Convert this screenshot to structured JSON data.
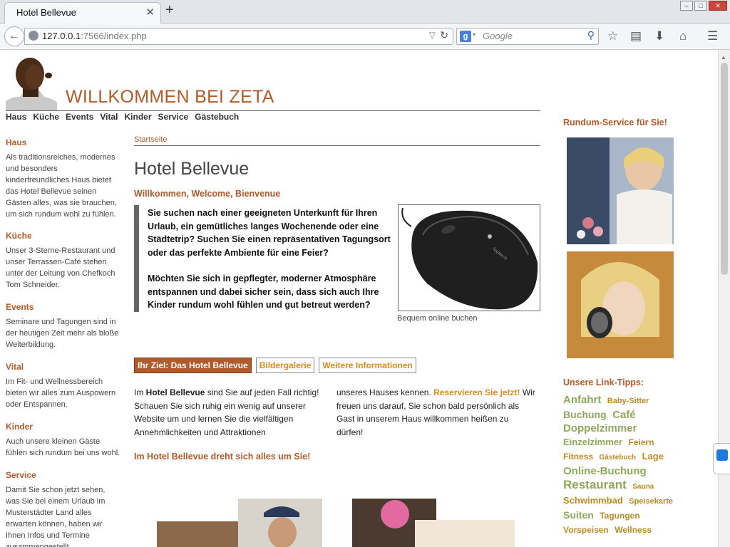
{
  "browser": {
    "tab_title": "Hotel Bellevue",
    "tab_close": "✕",
    "new_tab": "+",
    "url_host": "127.0.0.1",
    "url_path": ":7566/index.php",
    "search_placeholder": "Google",
    "search_engine_icon": "google-icon"
  },
  "site": {
    "welcome": "WILLKOMMEN BEI ZETA",
    "nav": [
      "Haus",
      "Küche",
      "Events",
      "Vital",
      "Kinder",
      "Service",
      "Gästebuch"
    ]
  },
  "sidebar_left": [
    {
      "title": "Haus",
      "text": "Als traditionsreiches, modernes und besonders kinderfreundliches Haus bietet das Hotel Bellevue seinen Gästen alles, was sie brauchen, um sich rundum wohl zu fühlen."
    },
    {
      "title": "Küche",
      "text": "Unser 3-Sterne-Restaurant und unser Terrassen-Café stehen unter der Leitung von Chefkoch Tom Schneider."
    },
    {
      "title": "Events",
      "text": "Seminare und Tagungen sind in der heutigen Zeit mehr als bloße Weiterbildung."
    },
    {
      "title": "Vital",
      "text": "Im Fit- und Wellnessbereich bieten wir alles zum Auspowern oder Entspannen."
    },
    {
      "title": "Kinder",
      "text": "Auch unsere kleinen Gäste fühlen sich rundum bei uns wohl."
    },
    {
      "title": "Service",
      "text": "Damit Sie schon jetzt sehen, was Sie bei einem Urlaub im Musterstädter Land alles erwarten können, haben wir Ihnen Infos und Termine zusammengestellt."
    }
  ],
  "main": {
    "breadcrumb": "Startseite",
    "title": "Hotel Bellevue",
    "subtitle": "Willkommen, Welcome, Bienvenue",
    "quote_p1": "Sie suchen nach einer geeigneten Unterkunft für Ihren Urlaub, ein gemütliches langes Wochenende oder eine Städtetrip? Suchen Sie einen repräsentativen Tagungsort oder das perfekte Ambiente für eine Feier?",
    "quote_p2": "Möchten Sie sich in gepflegter, moderner Atmosphäre entspannen und dabei sicher sein, dass sich auch Ihre Kinder rundum wohl fühlen und gut betreut werden?",
    "image_caption": "Bequem online buchen",
    "tabs": [
      "Ihr Ziel: Das Hotel Bellevue",
      "Bildergalerie",
      "Weitere Informationen"
    ],
    "col1_pre": "Im ",
    "col1_bold": "Hotel Bellevue",
    "col1_post": " sind Sie auf jeden Fall richtig! Schauen Sie sich ruhig ein wenig auf unserer Website um und lernen Sie die vielfältigen Annehmlichkeiten und Attraktionen",
    "col2_pre": "unseres Hauses kennen. ",
    "col2_link": "Reservieren Sie jetzt!",
    "col2_post": " Wir freuen uns darauf, Sie schon bald persönlich als Gast in unserem Haus willkommen heißen zu dürfen!",
    "tagline": "Im Hotel Bellevue dreht sich alles um Sie!"
  },
  "sidebar_right": {
    "service_title": "Rundum-Service für Sie!",
    "links_title": "Unsere Link-Tipps:",
    "tags": [
      {
        "text": "Anfahrt",
        "size": 15,
        "color": "#8fa85a"
      },
      {
        "text": "Baby-Sitter",
        "size": 11,
        "color": "#c08a22"
      },
      {
        "text": "Buchung",
        "size": 14,
        "color": "#8fa85a"
      },
      {
        "text": "Café",
        "size": 15,
        "color": "#8fa85a"
      },
      {
        "text": "Doppelzimmer",
        "size": 15,
        "color": "#8fa85a"
      },
      {
        "text": "Einzelzimmer",
        "size": 13,
        "color": "#8fa85a"
      },
      {
        "text": "Feiern",
        "size": 12,
        "color": "#c08a22"
      },
      {
        "text": "Fitness",
        "size": 12,
        "color": "#c08a22"
      },
      {
        "text": "Gästebuch",
        "size": 10,
        "color": "#c08a22"
      },
      {
        "text": "Lage",
        "size": 13,
        "color": "#c08a22"
      },
      {
        "text": "Online-Buchung",
        "size": 15,
        "color": "#8fa85a"
      },
      {
        "text": "Restaurant",
        "size": 17,
        "color": "#8fa85a"
      },
      {
        "text": "Sauna",
        "size": 10,
        "color": "#c08a22"
      },
      {
        "text": "Schwimmbad",
        "size": 13,
        "color": "#c08a22"
      },
      {
        "text": "Speisekarte",
        "size": 11,
        "color": "#c08a22"
      },
      {
        "text": "Suiten",
        "size": 14,
        "color": "#8fa85a"
      },
      {
        "text": "Tagungen",
        "size": 12,
        "color": "#c08a22"
      },
      {
        "text": "Vorspeisen",
        "size": 12,
        "color": "#c08a22"
      },
      {
        "text": "Wellness",
        "size": 12,
        "color": "#c08a22"
      }
    ]
  }
}
